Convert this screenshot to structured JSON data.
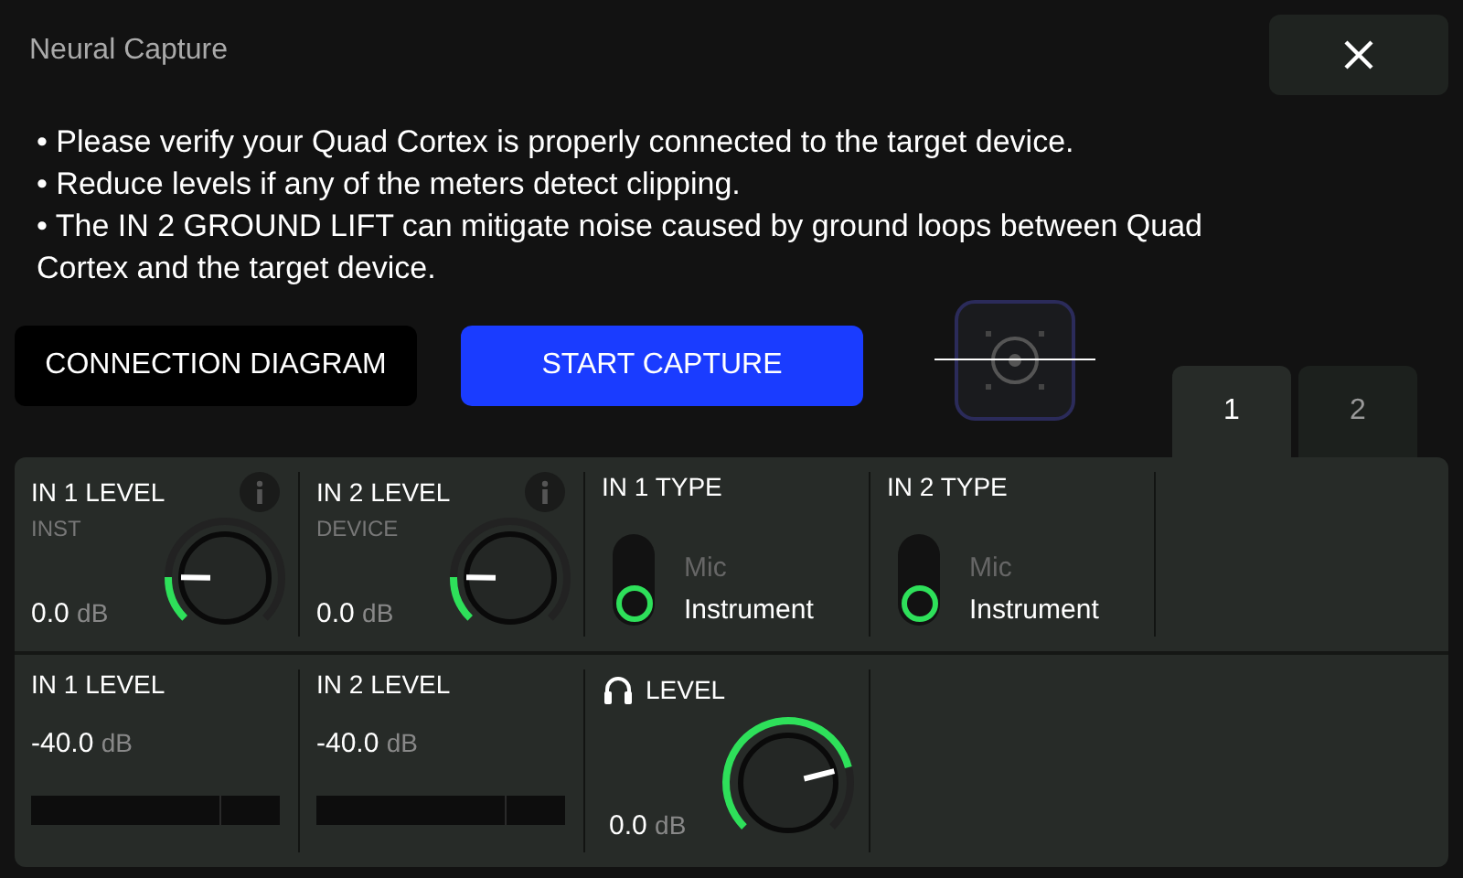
{
  "window": {
    "title": "Neural Capture"
  },
  "instructions": [
    "• Please verify your Quad Cortex is properly connected to the target device.",
    "• Reduce levels if any of the meters detect clipping.",
    "• The IN 2 GROUND LIFT can mitigate noise caused by ground loops between Quad Cortex and the target device."
  ],
  "buttons": [
    {
      "label": "CONNECTION DIAGRAM",
      "kind": "secondary"
    },
    {
      "label": "START CAPTURE",
      "kind": "primary"
    }
  ],
  "tabs": [
    {
      "label": "1",
      "selected": true
    },
    {
      "label": "2",
      "selected": false
    }
  ],
  "controls": [
    {
      "kind": "knob",
      "title": "IN 1 LEVEL",
      "sublabel": "INST",
      "value": "0.0",
      "unit": "dB"
    },
    {
      "kind": "knob",
      "title": "IN 2 LEVEL",
      "sublabel": "DEVICE",
      "value": "0.0",
      "unit": "dB"
    },
    {
      "kind": "switch",
      "title": "IN 1 TYPE",
      "options": [
        {
          "label": "Mic",
          "selected": false
        },
        {
          "label": "Instrument",
          "selected": true
        }
      ]
    },
    {
      "kind": "switch",
      "title": "IN 2 TYPE",
      "options": [
        {
          "label": "Mic",
          "selected": false
        },
        {
          "label": "Instrument",
          "selected": true
        }
      ]
    }
  ],
  "meters": [
    {
      "kind": "meter",
      "title": "IN 1 LEVEL",
      "value": "-40.0",
      "unit": "dB"
    },
    {
      "kind": "meter",
      "title": "IN 2 LEVEL",
      "value": "-40.0",
      "unit": "dB"
    },
    {
      "kind": "headphone_knob",
      "title": "LEVEL",
      "value": "0.0",
      "unit": "dB"
    }
  ]
}
